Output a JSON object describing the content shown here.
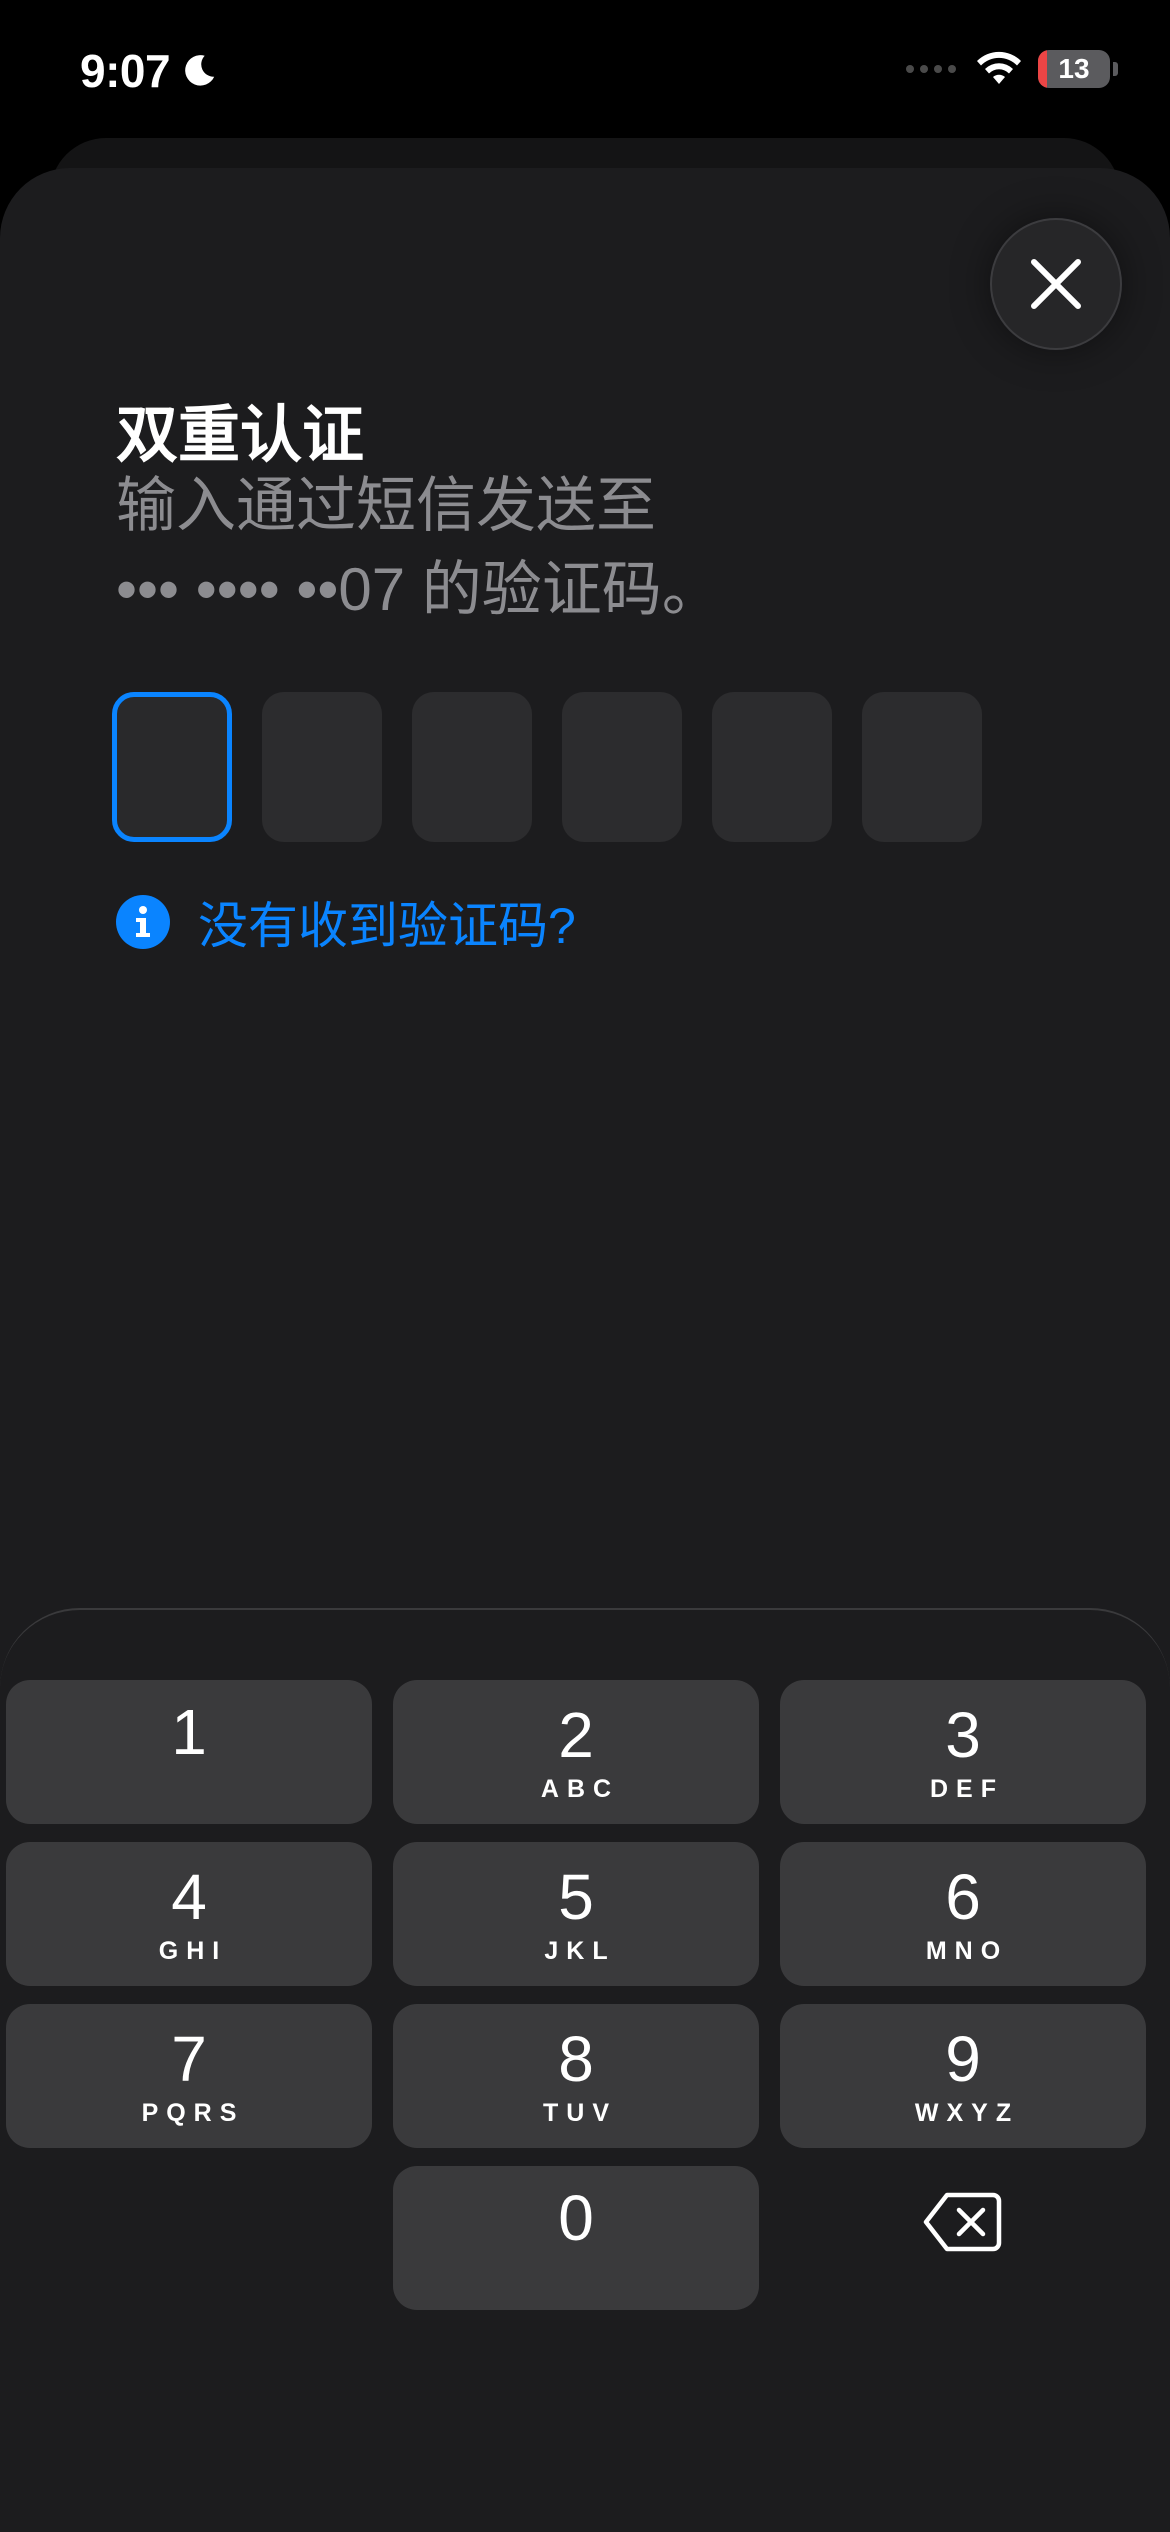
{
  "status_bar": {
    "time": "9:07",
    "battery_level": "13",
    "battery_fraction": 0.13,
    "icons": [
      "moon-icon",
      "cellular-signal-icon",
      "wifi-icon",
      "battery-icon"
    ]
  },
  "dialog": {
    "title": "双重认证",
    "subtitle_line1": "输入通过短信发送至",
    "subtitle_line2": "••• •••• ••07 的验证码。",
    "code_digits": [
      "",
      "",
      "",
      "",
      "",
      ""
    ],
    "active_index": 0,
    "no_code_link": "没有收到验证码?",
    "close_icon": "close-icon",
    "accent_color": "#0a84ff"
  },
  "keypad": {
    "keys": [
      {
        "digit": "1",
        "letters": ""
      },
      {
        "digit": "2",
        "letters": "ABC"
      },
      {
        "digit": "3",
        "letters": "DEF"
      },
      {
        "digit": "4",
        "letters": "GHI"
      },
      {
        "digit": "5",
        "letters": "JKL"
      },
      {
        "digit": "6",
        "letters": "MNO"
      },
      {
        "digit": "7",
        "letters": "PQRS"
      },
      {
        "digit": "8",
        "letters": "TUV"
      },
      {
        "digit": "9",
        "letters": "WXYZ"
      },
      {
        "digit": "0",
        "letters": ""
      }
    ],
    "delete_icon": "backspace-icon"
  }
}
